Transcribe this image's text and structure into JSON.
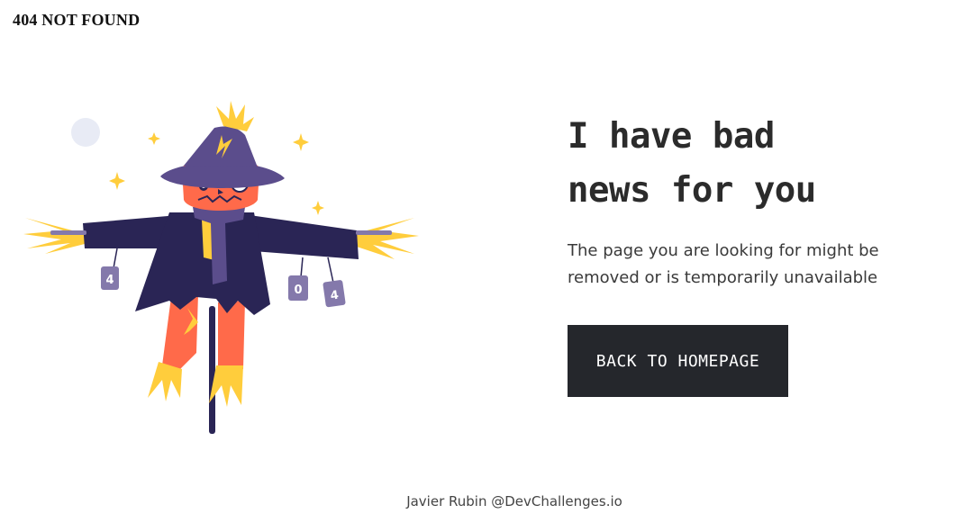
{
  "page": {
    "top_title": "404 NOT FOUND"
  },
  "main": {
    "headline_line1": "I have bad",
    "headline_line2": "news for you",
    "subtext_line1": "The page you are looking for might be",
    "subtext_line2": "removed or is temporarily unavailable",
    "cta_label": "BACK TO HOMEPAGE"
  },
  "illustration": {
    "can_labels": [
      "4",
      "0",
      "4"
    ],
    "colors": {
      "hat": "#5b4d8c",
      "coat": "#2a2555",
      "face": "#ff6a4a",
      "straw": "#ffcd3c",
      "pole": "#2a2555",
      "moon": "#e8ebf5",
      "can": "#8479ab"
    }
  },
  "footer": {
    "credit": "Javier Rubin @DevChallenges.io"
  },
  "theme": {
    "button_bg": "#25272c",
    "button_text": "#ffffff"
  }
}
